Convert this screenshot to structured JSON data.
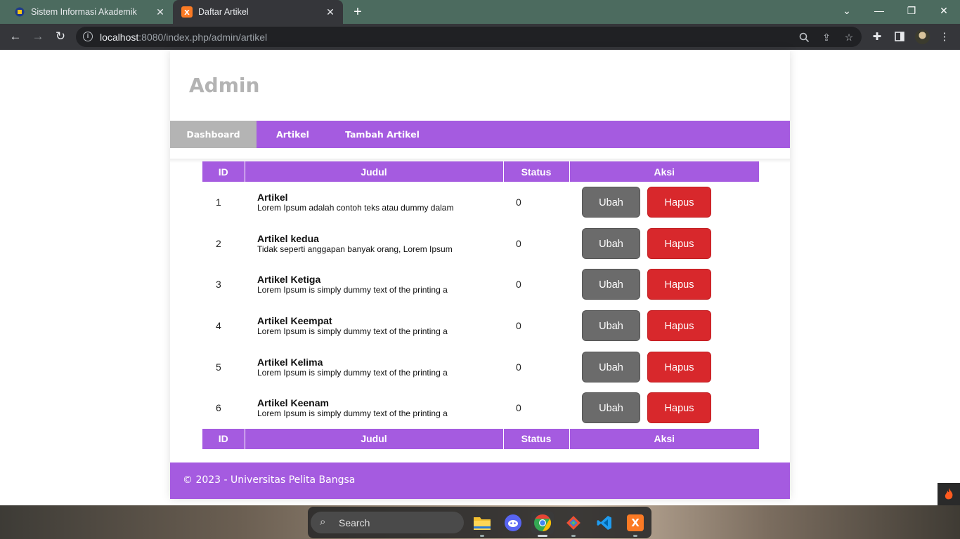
{
  "browser": {
    "tabs": [
      {
        "title": "Sistem Informasi Akademik",
        "active": false
      },
      {
        "title": "Daftar Artikel",
        "active": true
      }
    ],
    "url_host": "localhost",
    "url_rest": ":8080/index.php/admin/artikel",
    "new_tab": "+",
    "close_glyph": "✕"
  },
  "site": {
    "title": "Admin",
    "nav": [
      {
        "label": "Dashboard",
        "active": true
      },
      {
        "label": "Artikel",
        "active": false
      },
      {
        "label": "Tambah Artikel",
        "active": false
      }
    ]
  },
  "table": {
    "headers": [
      "ID",
      "Judul",
      "Status",
      "Aksi"
    ],
    "rows": [
      {
        "id": "1",
        "title": "Artikel",
        "desc": "Lorem Ipsum adalah contoh teks atau dummy dalam",
        "status": "0"
      },
      {
        "id": "2",
        "title": "Artikel kedua",
        "desc": "Tidak seperti anggapan banyak orang, Lorem Ipsum",
        "status": "0"
      },
      {
        "id": "3",
        "title": "Artikel Ketiga",
        "desc": "Lorem Ipsum is simply dummy text of the printing a",
        "status": "0"
      },
      {
        "id": "4",
        "title": "Artikel Keempat",
        "desc": "Lorem Ipsum is simply dummy text of the printing a",
        "status": "0"
      },
      {
        "id": "5",
        "title": "Artikel Kelima",
        "desc": "Lorem Ipsum is simply dummy text of the printing a",
        "status": "0"
      },
      {
        "id": "6",
        "title": "Artikel Keenam",
        "desc": "Lorem Ipsum is simply dummy text of the printing a",
        "status": "0"
      }
    ],
    "edit_label": "Ubah",
    "delete_label": "Hapus"
  },
  "footer": {
    "text": "© 2023 - Universitas Pelita Bangsa"
  },
  "taskbar": {
    "search_label": "Search",
    "apps": [
      "file-explorer",
      "discord",
      "chrome",
      "git",
      "vscode",
      "xampp"
    ]
  },
  "colors": {
    "accent": "#a55be0",
    "active_nav": "#b4b4b4",
    "edit_button": "#6b6b6b",
    "delete_button": "#d8282c",
    "title_gray": "#b3b3b3"
  }
}
